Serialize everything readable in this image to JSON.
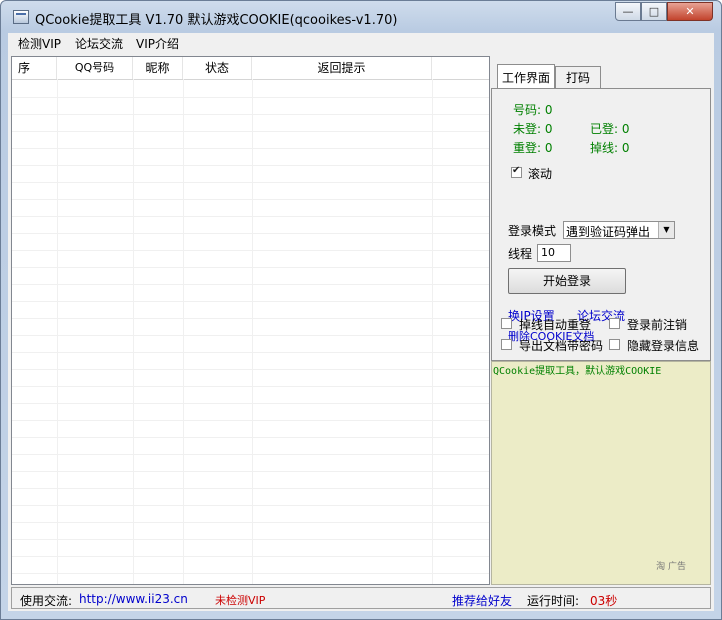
{
  "window": {
    "title": "QCookie提取工具 V1.70 默认游戏COOKIE(qcooikes-v1.70)",
    "controls": {
      "minimize": "—",
      "maximize": "□",
      "close": "✕"
    }
  },
  "menu": [
    {
      "label": "检测VIP"
    },
    {
      "label": "论坛交流"
    },
    {
      "label": "VIP介绍"
    }
  ],
  "table": {
    "columns": [
      "序",
      "QQ号码",
      "昵称",
      "状态",
      "返回提示"
    ]
  },
  "tabs": [
    {
      "label": "工作界面"
    },
    {
      "label": "打码"
    }
  ],
  "stats": {
    "number": "号码: 0",
    "not_logged": "未登: 0",
    "logged": "已登: 0",
    "relogin": "重登: 0",
    "dropped": "掉线: 0"
  },
  "options": {
    "scroll_label": "滚动",
    "login_mode_label": "登录模式",
    "login_mode_value": "遇到验证码弹出",
    "threads_label": "线程",
    "threads_value": "10",
    "start_button": "开始登录"
  },
  "links": {
    "ip_settings": "换IP设置",
    "forum": "论坛交流",
    "delete_cookie": "删除COOKIE文档"
  },
  "checkboxes": [
    {
      "label": "掉线自动重登"
    },
    {
      "label": "登录前注销"
    },
    {
      "label": "导出文档带密码"
    },
    {
      "label": "隐藏登录信息"
    }
  ],
  "log": {
    "text": "QCookie提取工具，默认游戏COOKIE",
    "ad": "淘 广告"
  },
  "status": {
    "exchange_label": "使用交流:",
    "url": "http://www.ii23.cn",
    "vip_status": "未检测VIP",
    "recommend": "推荐给好友",
    "runtime_label": "运行时间:",
    "runtime_value": "03秒"
  },
  "colors": {
    "stat_green": "#008000",
    "link_blue": "#0000cc",
    "alert_red": "#cc0000",
    "log_bg": "#ececc7"
  }
}
